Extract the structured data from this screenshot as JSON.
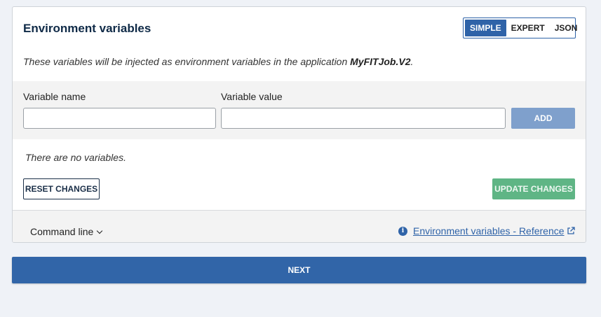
{
  "card": {
    "title": "Environment variables",
    "modes": [
      {
        "label": "SIMPLE",
        "active": true
      },
      {
        "label": "EXPERT",
        "active": false
      },
      {
        "label": "JSON",
        "active": false
      }
    ],
    "description_prefix": "These variables will be injected as environment variables in the application ",
    "app_name": "MyFITJob.V2",
    "description_suffix": "."
  },
  "form": {
    "name_label": "Variable name",
    "name_value": "",
    "value_label": "Variable value",
    "value_value": "",
    "add_label": "ADD"
  },
  "variables": {
    "empty_message": "There are no variables."
  },
  "actions": {
    "reset_label": "RESET CHANGES",
    "update_label": "UPDATE CHANGES"
  },
  "footer": {
    "command_line_label": "Command line",
    "reference_link": "Environment variables - Reference"
  },
  "next_label": "NEXT",
  "colors": {
    "primary": "#3165a8",
    "success": "#5fb585",
    "page_bg": "#eff2f7"
  }
}
